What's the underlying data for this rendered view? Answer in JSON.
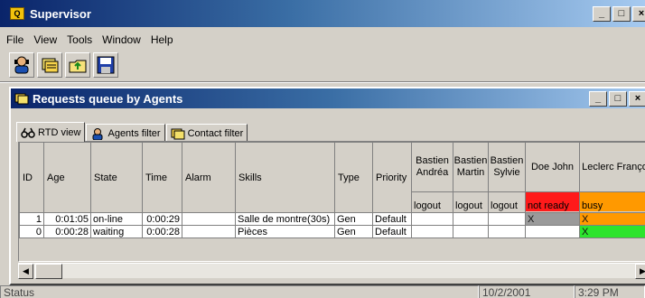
{
  "window": {
    "title": "Supervisor"
  },
  "menu": [
    "File",
    "View",
    "Tools",
    "Window",
    "Help"
  ],
  "toolbar": [
    "agent-icon",
    "contacts-icon",
    "folder-up-icon",
    "save-icon"
  ],
  "child": {
    "title": "Requests queue by Agents",
    "tabs": [
      {
        "label": "RTD view",
        "icon": "binoculars-icon"
      },
      {
        "label": "Agents filter",
        "icon": "agents-icon"
      },
      {
        "label": "Contact filter",
        "icon": "contacts-icon"
      }
    ]
  },
  "grid": {
    "columns": [
      "ID",
      "Age",
      "State",
      "Time",
      "Alarm",
      "Skills",
      "Type",
      "Priority"
    ],
    "agents": [
      {
        "name": "Bastien Andréa",
        "status": "logout",
        "color": "#d4d0c8"
      },
      {
        "name": "Bastien Martin",
        "status": "logout",
        "color": "#d4d0c8"
      },
      {
        "name": "Bastien Sylvie",
        "status": "logout",
        "color": "#d4d0c8"
      },
      {
        "name": "Doe John",
        "status": "not ready",
        "color": "#ff1a1a"
      },
      {
        "name": "Leclerc François",
        "status": "busy",
        "color": "#ff9900"
      }
    ],
    "rows": [
      {
        "id": "1",
        "age": "0:01:05",
        "state": "on-line",
        "time": "0:00:29",
        "alarm_color": "#2de42d",
        "skills": "Salle de montre(30s)",
        "type": "Gen",
        "priority": "Default",
        "agents": [
          "",
          "",
          "",
          "X",
          "X"
        ]
      },
      {
        "id": "0",
        "age": "0:00:28",
        "state": "waiting",
        "time": "0:00:28",
        "alarm_color": "#2de42d",
        "skills": "Pièces",
        "type": "Gen",
        "priority": "Default",
        "agents": [
          "",
          "",
          "",
          "",
          "X"
        ]
      }
    ]
  },
  "status": {
    "text": "Status",
    "date": "10/2/2001",
    "time": "3:29 PM"
  }
}
